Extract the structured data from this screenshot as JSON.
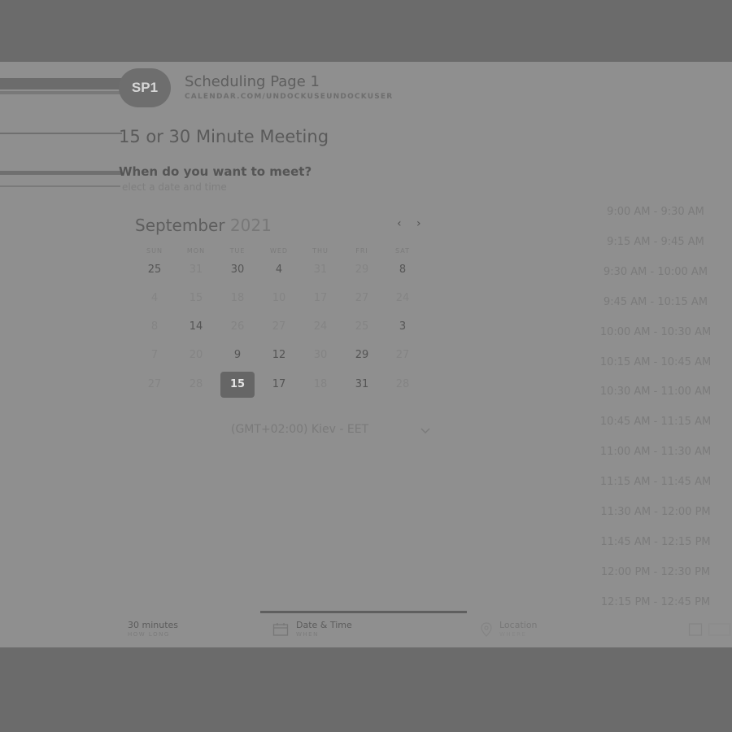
{
  "header": {
    "avatar_initials": "SP1",
    "page_name": "Scheduling Page 1",
    "page_url": "CALENDAR.COM/UNDOCKUSEUNDOCKUSER"
  },
  "event": {
    "title": "15 or 30 Minute Meeting",
    "question": "When do you want to meet?",
    "subtitle": "elect a date and time"
  },
  "calendar": {
    "month": "September",
    "year": "2021",
    "weekdays": [
      "SUN",
      "MON",
      "TUE",
      "WED",
      "THU",
      "FRI",
      "SAT"
    ],
    "weeks": [
      [
        {
          "d": "25",
          "s": "available"
        },
        {
          "d": "31",
          "s": "unavailable"
        },
        {
          "d": "30",
          "s": "available"
        },
        {
          "d": "4",
          "s": "available"
        },
        {
          "d": "31",
          "s": "unavailable"
        },
        {
          "d": "29",
          "s": "unavailable"
        },
        {
          "d": "8",
          "s": "available"
        }
      ],
      [
        {
          "d": "4",
          "s": "unavailable"
        },
        {
          "d": "15",
          "s": "unavailable"
        },
        {
          "d": "18",
          "s": "unavailable"
        },
        {
          "d": "10",
          "s": "unavailable"
        },
        {
          "d": "17",
          "s": "unavailable"
        },
        {
          "d": "27",
          "s": "unavailable"
        },
        {
          "d": "24",
          "s": "unavailable"
        }
      ],
      [
        {
          "d": "8",
          "s": "unavailable"
        },
        {
          "d": "14",
          "s": "available"
        },
        {
          "d": "26",
          "s": "unavailable"
        },
        {
          "d": "27",
          "s": "unavailable"
        },
        {
          "d": "24",
          "s": "unavailable"
        },
        {
          "d": "25",
          "s": "unavailable"
        },
        {
          "d": "3",
          "s": "available"
        }
      ],
      [
        {
          "d": "7",
          "s": "unavailable"
        },
        {
          "d": "20",
          "s": "unavailable"
        },
        {
          "d": "9",
          "s": "available"
        },
        {
          "d": "12",
          "s": "available"
        },
        {
          "d": "30",
          "s": "unavailable"
        },
        {
          "d": "29",
          "s": "available"
        },
        {
          "d": "27",
          "s": "unavailable"
        }
      ],
      [
        {
          "d": "27",
          "s": "unavailable"
        },
        {
          "d": "28",
          "s": "unavailable"
        },
        {
          "d": "15",
          "s": "selected"
        },
        {
          "d": "17",
          "s": "available"
        },
        {
          "d": "18",
          "s": "unavailable"
        },
        {
          "d": "31",
          "s": "available"
        },
        {
          "d": "28",
          "s": "unavailable"
        }
      ]
    ],
    "prev_label": "‹",
    "next_label": "›"
  },
  "timezone": {
    "label": "(GMT+02:00) Kiev - EET"
  },
  "timeslots": [
    "9:00 AM - 9:30 AM",
    "9:15 AM - 9:45 AM",
    "9:30 AM - 10:00 AM",
    "9:45 AM - 10:15 AM",
    "10:00 AM - 10:30 AM",
    "10:15 AM - 10:45 AM",
    "10:30 AM - 11:00 AM",
    "10:45 AM - 11:15 AM",
    "11:00 AM - 11:30 AM",
    "11:15 AM - 11:45 AM",
    "11:30 AM - 12:00 PM",
    "11:45 AM - 12:15 PM",
    "12:00 PM - 12:30 PM",
    "12:15 PM - 12:45 PM"
  ],
  "steps": {
    "duration": {
      "value": "30 minutes",
      "label": "HOW LONG"
    },
    "datetime": {
      "value": "Date & Time",
      "label": "WHEN"
    },
    "location": {
      "value": "Location",
      "label": "WHERE"
    }
  },
  "colors": {
    "overlay": "#6b6b6b",
    "panel": "#8f8f8f",
    "selected_day": "#666666"
  }
}
